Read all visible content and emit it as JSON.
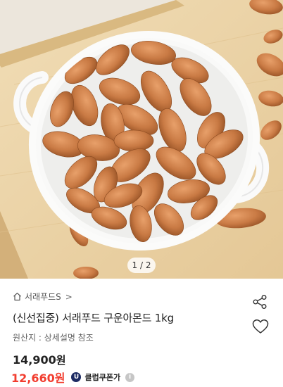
{
  "product_image": {
    "page_indicator": "1 / 2",
    "alt": ""
  },
  "store": {
    "name": "서래푸드S",
    "chevron": ">"
  },
  "product": {
    "title": "(신선집중) 서래푸드 구운아몬드 1kg",
    "origin": "원산지 : 상세설명 참조",
    "price_number": "14,900",
    "price_unit": "원",
    "sale_number": "12,660",
    "sale_unit": "원",
    "coupon_badge": "U",
    "coupon_label": "클럽쿠폰가",
    "coupon_info": "i"
  },
  "colors": {
    "sale_price": "#f23d2f",
    "coupon_badge": "#1d2b63"
  },
  "icons": {
    "store": "home-icon",
    "share": "share-icon",
    "wishlist": "heart-icon"
  }
}
